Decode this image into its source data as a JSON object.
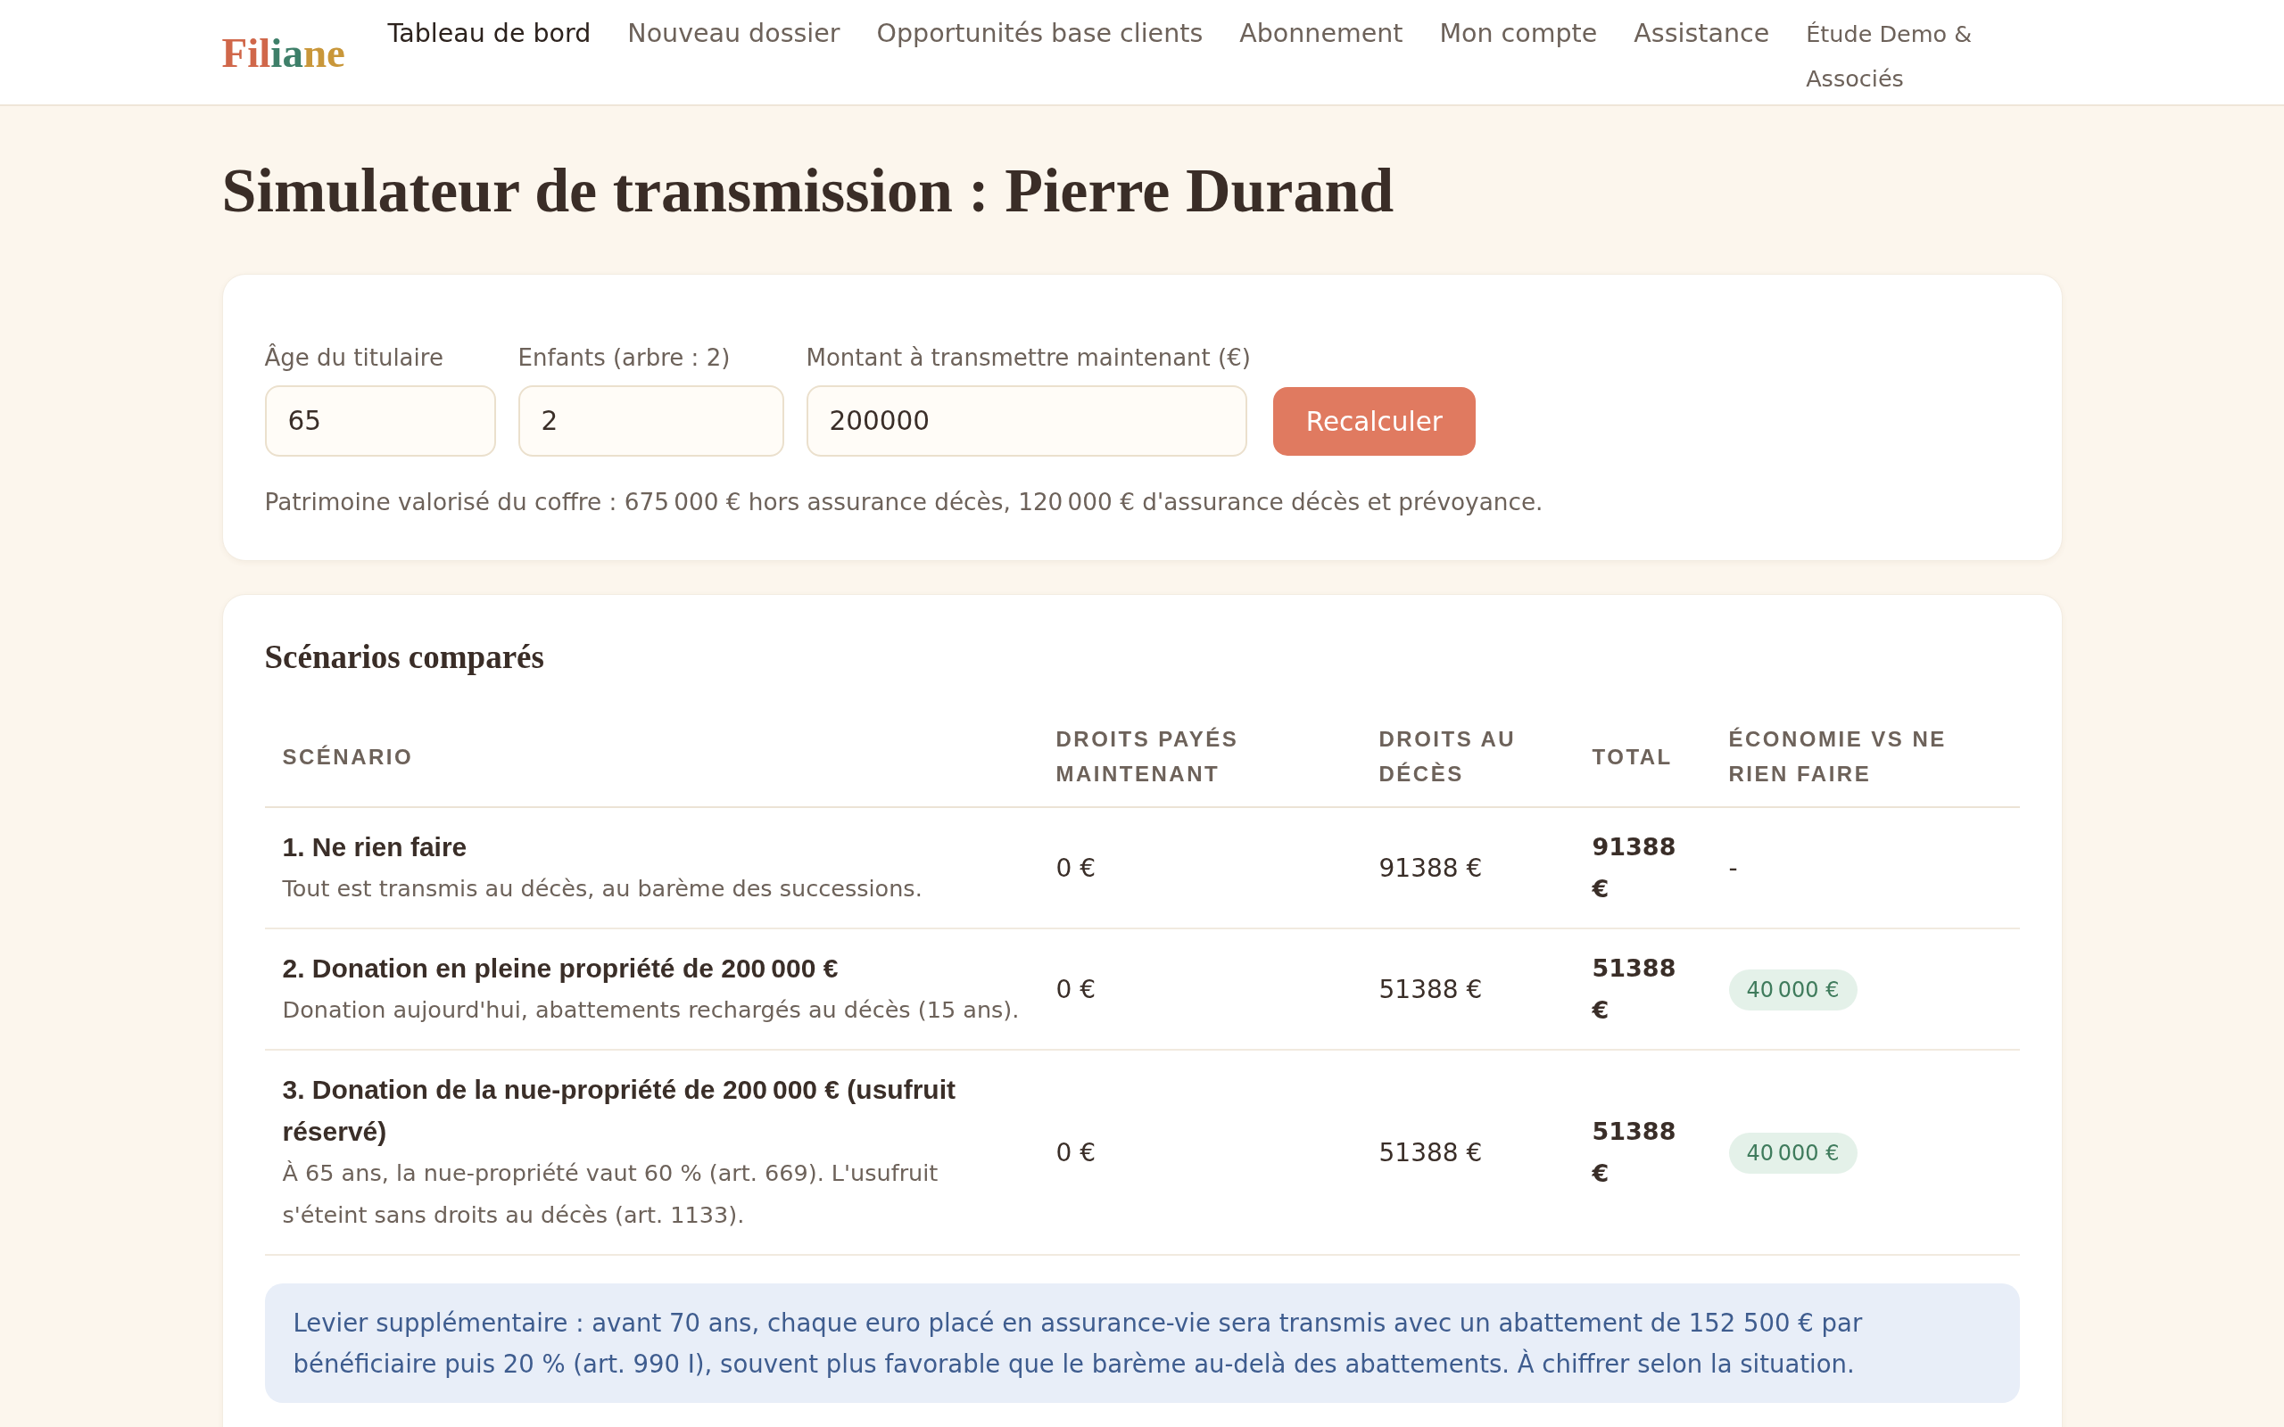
{
  "header": {
    "logo": [
      {
        "text": "Fil",
        "color": "#d0674a"
      },
      {
        "text": "ia",
        "color": "#3e7f69"
      },
      {
        "text": "ne",
        "color": "#c9973a"
      }
    ],
    "nav": [
      {
        "label": "Tableau de bord",
        "selected": true
      },
      {
        "label": "Nouveau dossier",
        "selected": false
      },
      {
        "label": "Opportunités base clients",
        "selected": false
      },
      {
        "label": "Abonnement",
        "selected": false
      },
      {
        "label": "Mon compte",
        "selected": false
      },
      {
        "label": "Assistance",
        "selected": false
      }
    ],
    "firm": "Étude Demo & Associés"
  },
  "title": "Simulateur de transmission : Pierre Durand",
  "form": {
    "fields": [
      {
        "label": "Âge du titulaire",
        "value": "65"
      },
      {
        "label": "Enfants (arbre : 2)",
        "value": "2"
      },
      {
        "label": "Montant à transmettre maintenant (€)",
        "value": "200000"
      }
    ],
    "button": "Recalculer",
    "summary": "Patrimoine valorisé du coffre : 675 000 € hors assurance décès, 120 000 € d'assurance décès et prévoyance."
  },
  "scenarios": {
    "title": "Scénarios comparés",
    "columns": [
      "SCÉNARIO",
      "DROITS PAYÉS MAINTENANT",
      "DROITS AU DÉCÈS",
      "TOTAL",
      "ÉCONOMIE VS NE RIEN FAIRE"
    ],
    "rows": [
      {
        "title": "1. Ne rien faire",
        "description": "Tout est transmis au décès, au barème des successions.",
        "paid_now": "0 €",
        "at_death": "91388 €",
        "total": "91388 €",
        "savings": {
          "kind": "text",
          "text": "-"
        }
      },
      {
        "title": "2. Donation en pleine propriété de 200 000 €",
        "description": "Donation aujourd'hui, abattements rechargés au décès (15 ans).",
        "paid_now": "0 €",
        "at_death": "51388 €",
        "total": "51388 €",
        "savings": {
          "kind": "badge",
          "text": "40 000 €"
        }
      },
      {
        "title": "3. Donation de la nue-propriété de 200 000 € (usufruit réservé)",
        "description": "À 65 ans, la nue-propriété vaut 60 % (art. 669). L'usufruit s'éteint sans droits au décès (art. 1133).",
        "paid_now": "0 €",
        "at_death": "51388 €",
        "total": "51388 €",
        "savings": {
          "kind": "badge",
          "text": "40 000 €"
        }
      }
    ],
    "note": "Levier supplémentaire : avant 70 ans, chaque euro placé en assurance-vie sera transmis avec un abattement de 152 500 € par bénéficiaire puis 20 % (art. 990 I), souvent plus favorable que le barème au-delà des abattements. À chiffrer selon la situation."
  }
}
